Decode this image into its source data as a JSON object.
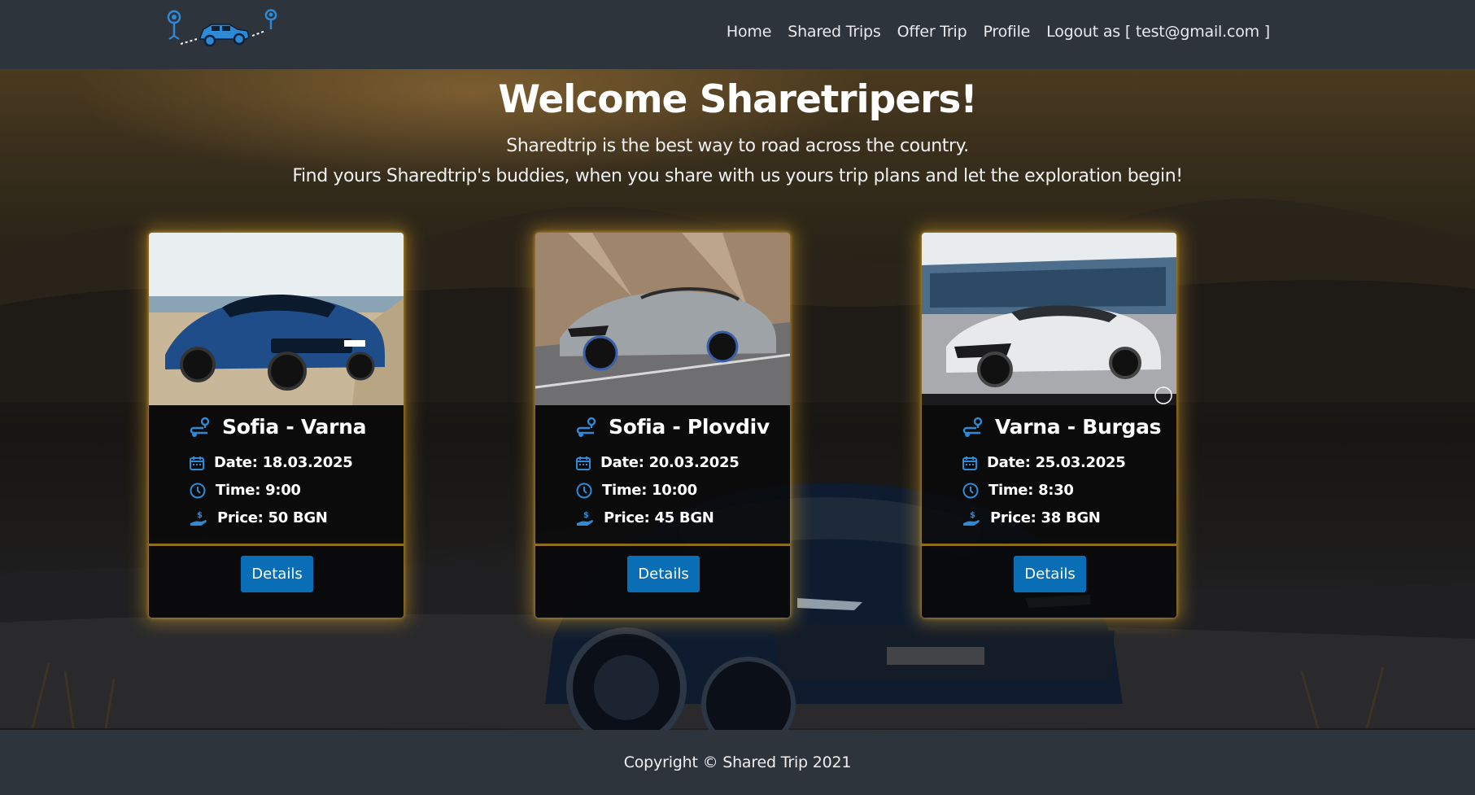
{
  "nav": {
    "logo_icon": "shared-trip-car-route-logo",
    "links": [
      "Home",
      "Shared Trips",
      "Offer Trip",
      "Profile",
      "Logout as [ test@gmail.com ]"
    ]
  },
  "hero": {
    "title": "Welcome Sharetripers!",
    "subtitle_1": "Sharedtrip is the best way to road across the country.",
    "subtitle_2": "Find yours Sharedtrip's buddies, when you share with us yours trip plans and let the exploration begin!"
  },
  "trips": [
    {
      "route": "Sofia - Varna",
      "date": "Date: 18.03.2025",
      "time": "Time: 9:00",
      "price": "Price: 50 BGN",
      "button": "Details",
      "car_color": "#1f4d8a",
      "image_scene": "blue-sports-sedan-beach"
    },
    {
      "route": "Sofia - Plovdiv",
      "date": "Date: 20.03.2025",
      "time": "Time: 10:00",
      "price": "Price: 45 BGN",
      "button": "Details",
      "car_color": "#9ea3a8",
      "image_scene": "silver-convertible-mountain-road"
    },
    {
      "route": "Varna - Burgas",
      "date": "Date: 25.03.2025",
      "time": "Time: 8:30",
      "price": "Price: 38 BGN",
      "button": "Details",
      "car_color": "#e8e9ea",
      "image_scene": "white-coupe-dealership"
    }
  ],
  "footer": {
    "copyright": "Copyright © Shared Trip 2021"
  },
  "colors": {
    "accent": "#0a6eb7",
    "icon": "#2f8ad6",
    "glow": "#e6aa28",
    "navbar": "#2e343c"
  }
}
